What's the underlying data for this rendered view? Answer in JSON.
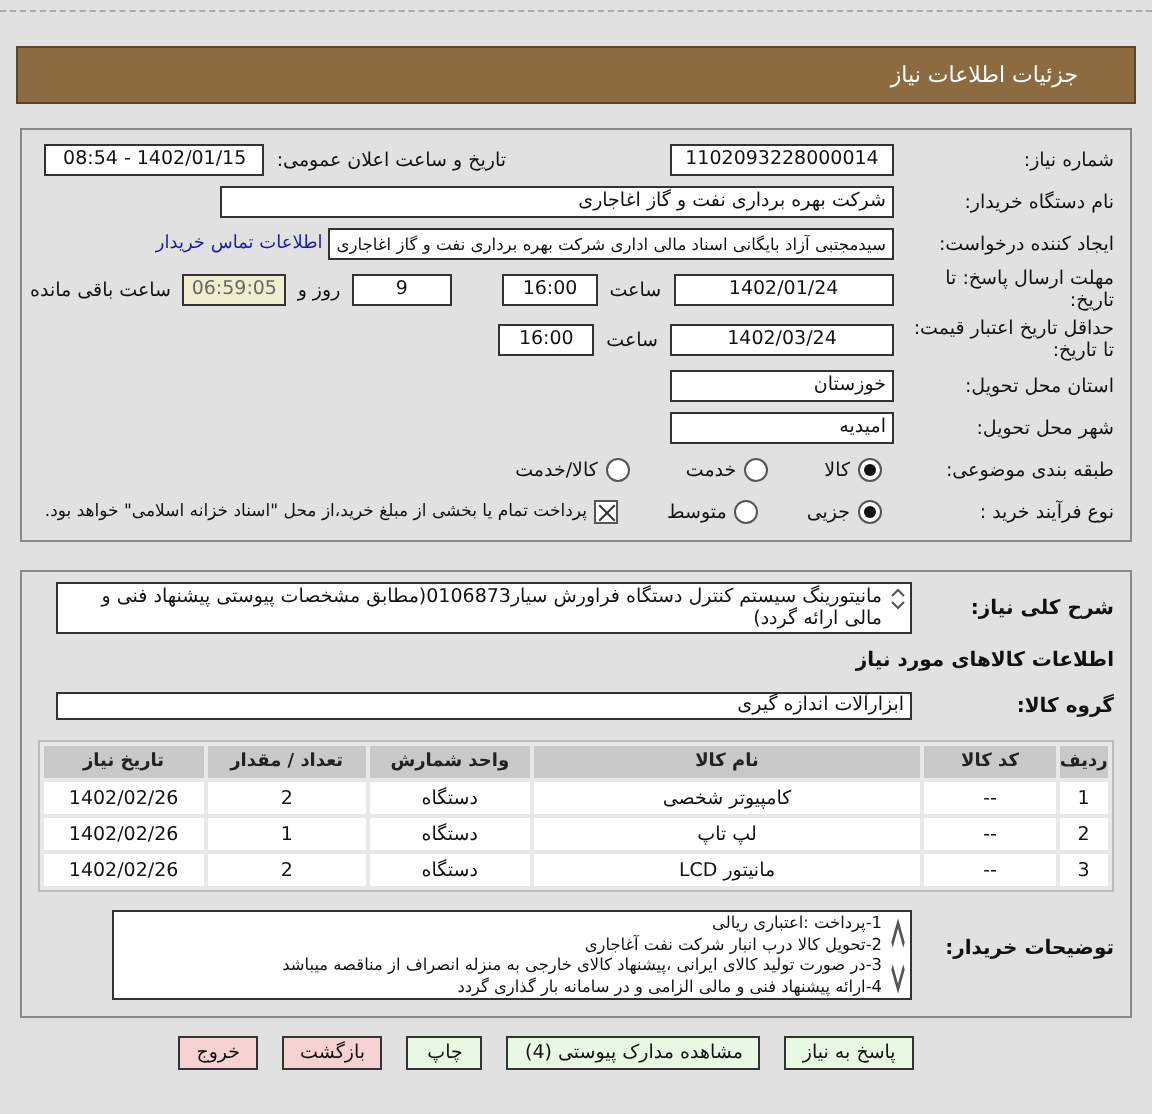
{
  "header": {
    "title": "جزئیات اطلاعات نیاز"
  },
  "need_number": {
    "label": "شماره نیاز:",
    "value": "1102093228000014"
  },
  "announce": {
    "label": "تاریخ و ساعت اعلان عمومی:",
    "value": "1402/01/15 - 08:54"
  },
  "buyer_org": {
    "label": "نام دستگاه خریدار:",
    "value": "شرکت بهره برداری نفت و گاز اغاجاری"
  },
  "requester": {
    "label": "ایجاد کننده درخواست:",
    "value": "سیدمجتبی آزاد بایگانی اسناد مالی اداری شرکت بهره برداری نفت و گاز اغاجاری",
    "link": "اطلاعات تماس خریدار"
  },
  "deadline": {
    "label": "مهلت ارسال پاسخ: تا تاریخ:",
    "date": "1402/01/24",
    "time_label": "ساعت",
    "time": "16:00",
    "days": "9",
    "days_label": "روز و",
    "remaining": "06:59:05",
    "remaining_label": "ساعت باقی مانده"
  },
  "validity": {
    "label": "حداقل تاریخ اعتبار قیمت: تا تاریخ:",
    "date": "1402/03/24",
    "time_label": "ساعت",
    "time": "16:00"
  },
  "province": {
    "label": "استان محل تحویل:",
    "value": "خوزستان"
  },
  "city": {
    "label": "شهر محل تحویل:",
    "value": "امیدیه"
  },
  "category": {
    "label": "طبقه بندی موضوعی:",
    "options": [
      {
        "label": "کالا",
        "selected": true
      },
      {
        "label": "خدمت",
        "selected": false
      },
      {
        "label": "کالا/خدمت",
        "selected": false
      }
    ]
  },
  "purchase_type": {
    "label": "نوع فرآیند خرید :",
    "options": [
      {
        "label": "جزیی",
        "selected": true
      },
      {
        "label": "متوسط",
        "selected": false
      }
    ],
    "payment": {
      "checked": true,
      "text": "پرداخت تمام یا بخشی از مبلغ خرید،از محل \"اسناد خزانه اسلامی\" خواهد بود."
    }
  },
  "description": {
    "label": "شرح کلی نیاز:",
    "text": "مانیتورینگ سیستم کنترل دستگاه فراورش سیار0106873(مطابق مشخصات پیوستی پیشنهاد فنی و مالی ارائه گردد)"
  },
  "goods_title": "اطلاعات کالاهای مورد نیاز",
  "goods_group": {
    "label": "گروه کالا:",
    "value": "ابزارآلات اندازه گیری"
  },
  "table": {
    "columns": [
      "ردیف",
      "کد کالا",
      "نام کالا",
      "واحد شمارش",
      "تعداد / مقدار",
      "تاریخ نیاز"
    ],
    "rows": [
      [
        "1",
        "--",
        "کامپیوتر شخصی",
        "دستگاه",
        "2",
        "1402/02/26"
      ],
      [
        "2",
        "--",
        "لپ تاپ",
        "دستگاه",
        "1",
        "1402/02/26"
      ],
      [
        "3",
        "--",
        "مانیتور LCD",
        "دستگاه",
        "2",
        "1402/02/26"
      ]
    ]
  },
  "buyer_notes": {
    "label": "توضیحات خریدار:",
    "lines": [
      "1-پرداخت :اعتباری ریالی",
      "2-تحویل کالا درب انبار شرکت نفت آغاجاری",
      "3-در صورت تولید کالای ایرانی ،پیشنهاد کالای خارجی به منزله انصراف از مناقصه میباشد",
      "4-ارائه پیشنهاد فنی و مالی الزامی و در سامانه بار گذاری گردد"
    ]
  },
  "buttons": [
    {
      "label": "پاسخ به نیاز",
      "kind": "primary"
    },
    {
      "label": "مشاهده مدارک پیوستی (4)",
      "kind": "primary"
    },
    {
      "label": "چاپ",
      "kind": "primary"
    },
    {
      "label": "بازگشت",
      "kind": "danger"
    },
    {
      "label": "خروج",
      "kind": "danger"
    }
  ]
}
